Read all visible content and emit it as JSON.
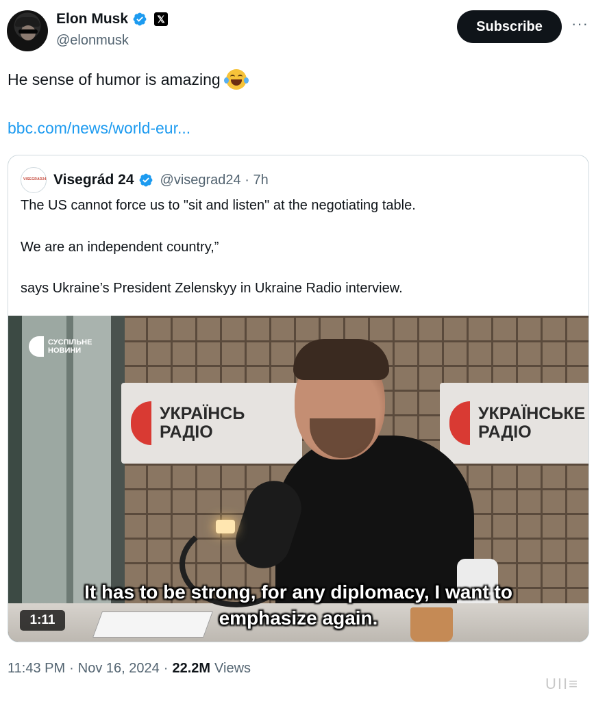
{
  "author": {
    "name": "Elon Musk",
    "handle": "@elonmusk",
    "verified_icon": "verified-badge-icon",
    "affiliate_icon": "x-logo-icon",
    "affiliate_glyph": "𝕏"
  },
  "actions": {
    "subscribe_label": "Subscribe",
    "more_label": "···"
  },
  "tweet": {
    "text": "He sense of humor is amazing",
    "emoji": "face-with-tears-of-joy-icon",
    "link_text": "bbc.com/news/world-eur..."
  },
  "quoted": {
    "avatar_label": "VISEGRAD24",
    "name": "Visegrád 24",
    "handle_time": "@visegrad24 · 7h",
    "paragraphs": [
      "The US cannot force us to \"sit and listen\" at the negotiating table.",
      "We are an independent country,”",
      "says Ukraine’s President Zelenskyy in Ukraine Radio interview."
    ],
    "video": {
      "channel_logo_text": "СУСПІЛЬНЕ\nНОВИНИ",
      "sign_left_text": "УКРАЇНСЬ\nРАДІО",
      "sign_right_text": "УКРАЇНСЬКЕ\nРАДІО",
      "subtitle": "It has to be strong, for any diplomacy, I want to\nemphasize again.",
      "duration": "1:11"
    }
  },
  "meta": {
    "time": "11:43 PM",
    "sep1": "·",
    "date": "Nov 16, 2024",
    "sep2": "·",
    "views_count": "22.2M",
    "views_label": "Views"
  },
  "watermark": "UII≡",
  "colors": {
    "link": "#1d9bf0",
    "verified": "#1d9bf0",
    "secondary_text": "#536471",
    "button_bg": "#0f1419"
  }
}
